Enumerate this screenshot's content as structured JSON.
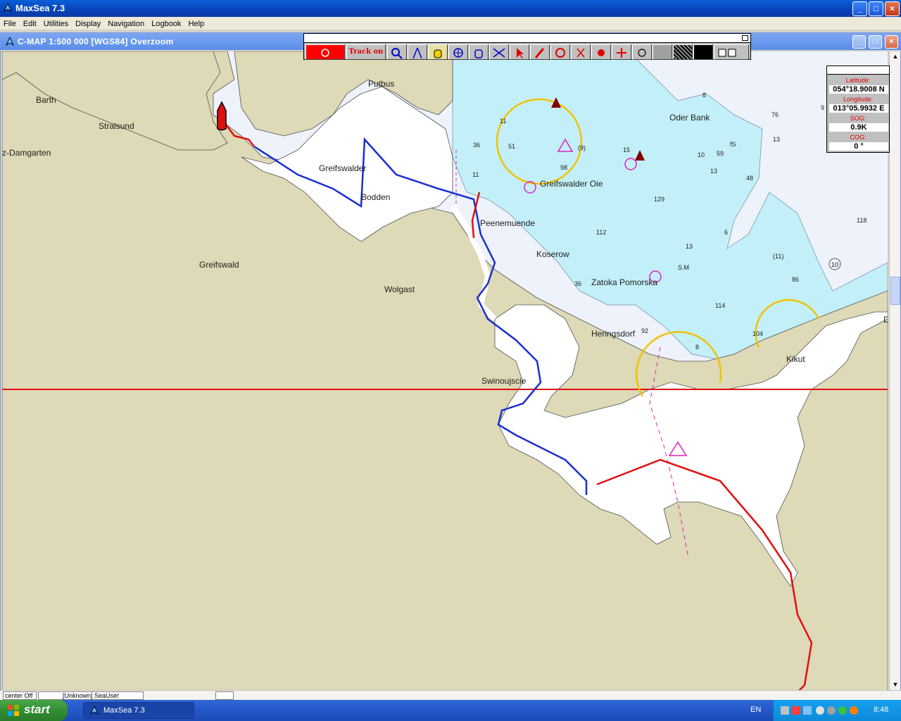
{
  "app": {
    "title": "MaxSea 7.3"
  },
  "menu": [
    "File",
    "Edit",
    "Utilities",
    "Display",
    "Navigation",
    "Logbook",
    "Help"
  ],
  "chart_window": {
    "title": "C-MAP  1:500 000 [WGS84]    Overzoom"
  },
  "toolbar": {
    "track_label": "Track on"
  },
  "position": {
    "lat_label": "Latitude:",
    "lat": "054°18.9008 N",
    "lon_label": "Longitude:",
    "lon": "013°05.9932 E",
    "sog_label": "SOG:",
    "sog": "0.9K",
    "cog_label": "COG:",
    "cog": "0 °"
  },
  "places": {
    "barth": "Barth",
    "stralsund": "Stralsund",
    "damgarten": "z-Damgarten",
    "putbus": "Putbus",
    "greifswalder": "Greifswalder",
    "bodden": "Bodden",
    "greifswald": "Greifswald",
    "wolgast": "Wolgast",
    "peenemuende": "Peenemuende",
    "greifswalder_oie": "Greifswalder Oie",
    "oder_bank": "Oder Bank",
    "koserow": "Koserow",
    "zatoka": "Zatoka Pomorska",
    "heringsdorf": "Heringsdorf",
    "swinoujscie": "Swinoujscie",
    "kikut": "Kikut",
    "d_edge": "D"
  },
  "depths": [
    "8",
    "9",
    "76",
    "13",
    "59",
    "15",
    "13",
    "48",
    "6",
    "129",
    "112",
    "13",
    "118",
    "114",
    "92",
    "104",
    "86",
    "10",
    "36",
    "11",
    "51",
    "98",
    "36",
    "8",
    "fS",
    "(9)",
    "(11)",
    "S.M",
    "10",
    "11"
  ],
  "bottom": {
    "center": "center Off",
    "user": "[Unknown] SeaUser"
  },
  "taskbar": {
    "start": "start",
    "task": "MaxSea 7.3",
    "lang": "EN",
    "clock": "8:48"
  },
  "colors": {
    "land": "#ded9b6",
    "shallow": "#c3f0f8",
    "deep": "#eef2fb",
    "track_red": "#e01010",
    "route_blue": "#1a2fd0",
    "sector": "#f2c200",
    "magenta": "#e020c0"
  }
}
